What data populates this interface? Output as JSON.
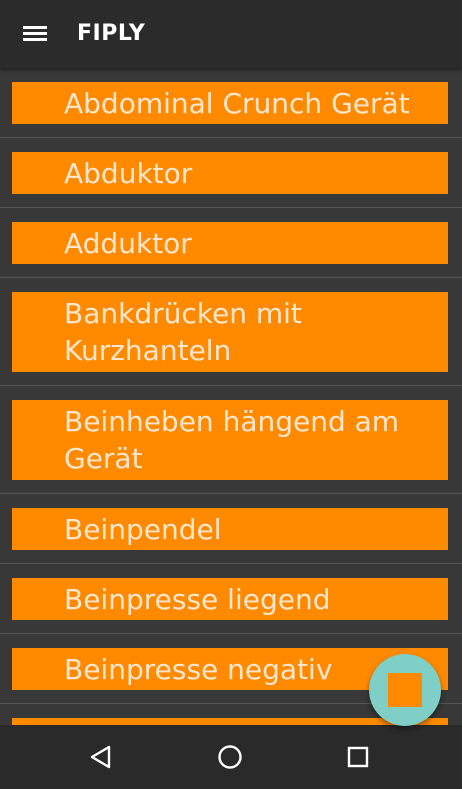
{
  "app": {
    "title": "FIPLY"
  },
  "icons": {
    "menu": "hamburger-menu-icon",
    "fab": "stop-square-icon",
    "back": "triangle-back-icon",
    "home": "circle-home-icon",
    "recents": "square-recents-icon"
  },
  "colors": {
    "appbar": "#2b2b2b",
    "background": "#383838",
    "item_background": "#ff8a00",
    "item_text": "#fbe7cf",
    "fab_background": "#7fcfc6",
    "fab_square": "#ff8a00",
    "navbar": "#2a2a2a"
  },
  "exercises": [
    "Abdominal Crunch Gerät",
    "Abduktor",
    "Adduktor",
    "Bankdrücken mit Kurzhanteln",
    "Beinheben hängend am Gerät",
    "Beinpendel",
    "Beinpresse liegend",
    "Beinpresse negativ"
  ]
}
